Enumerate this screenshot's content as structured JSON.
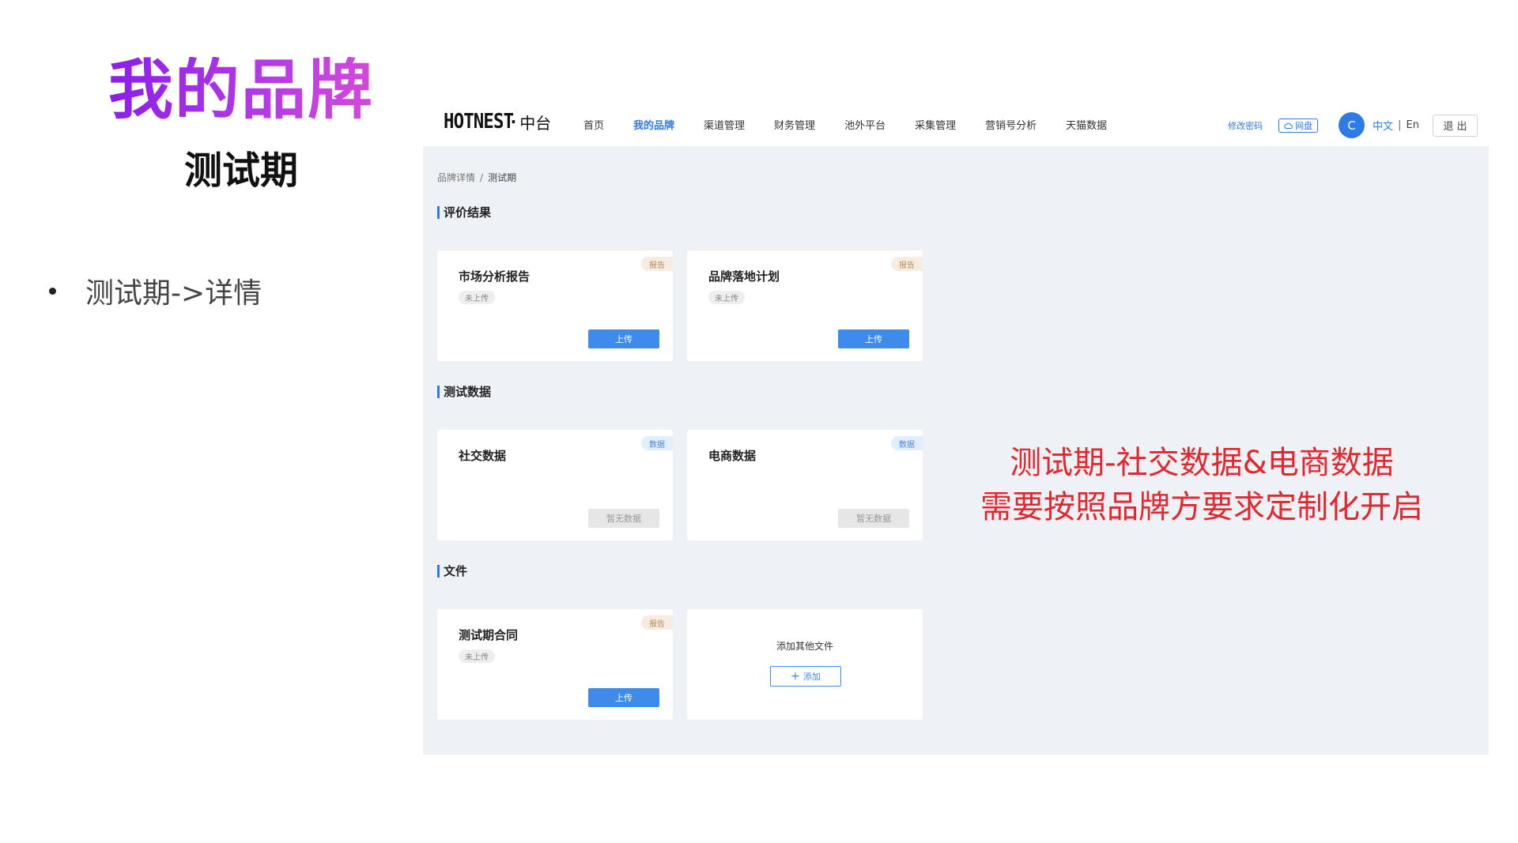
{
  "slide": {
    "title": "我的品牌",
    "subtitle": "测试期",
    "bullet": "测试期->详情",
    "annotation_line1": "测试期-社交数据&电商数据",
    "annotation_line2": "需要按照品牌方要求定制化开启"
  },
  "header": {
    "logo_text": "HOTNEST",
    "logo_sep": "·",
    "logo_sub": "中台",
    "nav": [
      "首页",
      "我的品牌",
      "渠道管理",
      "财务管理",
      "池外平台",
      "采集管理",
      "营销号分析",
      "天猫数据"
    ],
    "active_nav": "我的品牌",
    "change_password": "修改密码",
    "cloud_drive": "网盘",
    "avatar_letter": "C",
    "lang_zh": "中文",
    "lang_sep": "|",
    "lang_en": "En",
    "logout": "退 出"
  },
  "breadcrumb": {
    "parent": "品牌详情",
    "sep": "/",
    "current": "测试期"
  },
  "sections": {
    "evaluation": {
      "title": "评价结果",
      "cards": [
        {
          "title": "市场分析报告",
          "tag": "报告",
          "status": "未上传",
          "button": "上传"
        },
        {
          "title": "品牌落地计划",
          "tag": "报告",
          "status": "未上传",
          "button": "上传"
        }
      ]
    },
    "test_data": {
      "title": "测试数据",
      "cards": [
        {
          "title": "社交数据",
          "tag": "数据",
          "button": "暂无数据"
        },
        {
          "title": "电商数据",
          "tag": "数据",
          "button": "暂无数据"
        }
      ]
    },
    "files": {
      "title": "文件",
      "cards": [
        {
          "title": "测试期合同",
          "tag": "报告",
          "status": "未上传",
          "button": "上传"
        }
      ],
      "add_card": {
        "text": "添加其他文件",
        "button": "添加"
      }
    }
  },
  "colors": {
    "accent": "#2e7be6",
    "annotation": "#e0282e",
    "title_gradient_start": "#8a1de8",
    "title_gradient_end": "#d64bd8"
  }
}
